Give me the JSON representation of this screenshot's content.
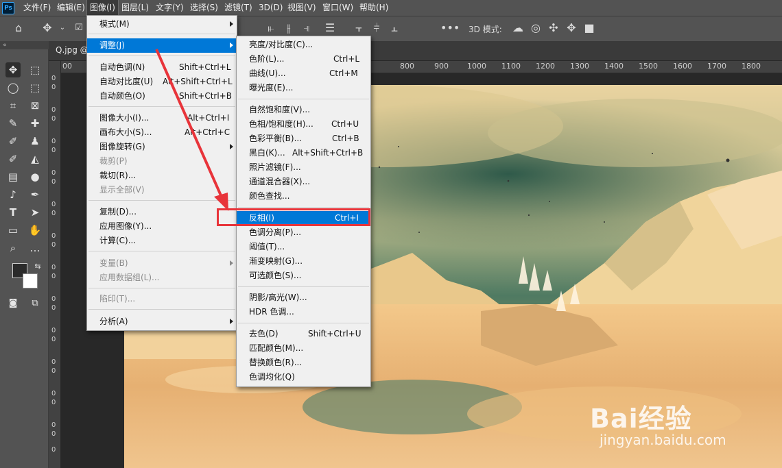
{
  "menubar": {
    "logo": "Ps",
    "items": [
      "文件(F)",
      "编辑(E)",
      "图像(I)",
      "图层(L)",
      "文字(Y)",
      "选择(S)",
      "滤镜(T)",
      "3D(D)",
      "视图(V)",
      "窗口(W)",
      "帮助(H)"
    ]
  },
  "options_bar": {
    "mode_3d_label": "3D 模式:"
  },
  "document": {
    "tab_label": "Q.jpg @",
    "ruler_h": [
      "00",
      "800",
      "900",
      "1000",
      "1100",
      "1200",
      "1300",
      "1400",
      "1500",
      "1600",
      "1700",
      "1800"
    ],
    "ruler_v": [
      "0",
      "0",
      "0",
      "0",
      "0",
      "0",
      "0",
      "0",
      "0",
      "0",
      "0",
      "0",
      "0",
      "0",
      "0",
      "0",
      "0",
      "0",
      "0",
      "0",
      "0",
      "0",
      "0",
      "0",
      "0",
      "0",
      "0",
      "0"
    ]
  },
  "image_menu": {
    "items": [
      {
        "label": "模式(M)",
        "shortcut": "",
        "disabled": false,
        "submenu": true
      },
      {
        "label": "调整(J)",
        "shortcut": "",
        "disabled": false,
        "submenu": true,
        "highlighted": true
      },
      {
        "label": "自动色调(N)",
        "shortcut": "Shift+Ctrl+L",
        "disabled": false
      },
      {
        "label": "自动对比度(U)",
        "shortcut": "Alt+Shift+Ctrl+L",
        "disabled": false
      },
      {
        "label": "自动颜色(O)",
        "shortcut": "Shift+Ctrl+B",
        "disabled": false
      },
      {
        "label": "图像大小(I)...",
        "shortcut": "Alt+Ctrl+I",
        "disabled": false
      },
      {
        "label": "画布大小(S)...",
        "shortcut": "Alt+Ctrl+C",
        "disabled": false
      },
      {
        "label": "图像旋转(G)",
        "shortcut": "",
        "disabled": false,
        "submenu": true
      },
      {
        "label": "裁剪(P)",
        "shortcut": "",
        "disabled": true
      },
      {
        "label": "裁切(R)...",
        "shortcut": "",
        "disabled": false
      },
      {
        "label": "显示全部(V)",
        "shortcut": "",
        "disabled": true
      },
      {
        "label": "复制(D)...",
        "shortcut": "",
        "disabled": false
      },
      {
        "label": "应用图像(Y)...",
        "shortcut": "",
        "disabled": false
      },
      {
        "label": "计算(C)...",
        "shortcut": "",
        "disabled": false
      },
      {
        "label": "变量(B)",
        "shortcut": "",
        "disabled": true,
        "submenu": true
      },
      {
        "label": "应用数据组(L)...",
        "shortcut": "",
        "disabled": true
      },
      {
        "label": "陷印(T)...",
        "shortcut": "",
        "disabled": true
      },
      {
        "label": "分析(A)",
        "shortcut": "",
        "disabled": false,
        "submenu": true
      }
    ]
  },
  "adjust_submenu": {
    "items": [
      {
        "label": "亮度/对比度(C)...",
        "shortcut": ""
      },
      {
        "label": "色阶(L)...",
        "shortcut": "Ctrl+L"
      },
      {
        "label": "曲线(U)...",
        "shortcut": "Ctrl+M"
      },
      {
        "label": "曝光度(E)...",
        "shortcut": ""
      },
      {
        "label": "自然饱和度(V)...",
        "shortcut": ""
      },
      {
        "label": "色相/饱和度(H)...",
        "shortcut": "Ctrl+U"
      },
      {
        "label": "色彩平衡(B)...",
        "shortcut": "Ctrl+B"
      },
      {
        "label": "黑白(K)...",
        "shortcut": "Alt+Shift+Ctrl+B"
      },
      {
        "label": "照片滤镜(F)...",
        "shortcut": ""
      },
      {
        "label": "通道混合器(X)...",
        "shortcut": ""
      },
      {
        "label": "颜色查找...",
        "shortcut": ""
      },
      {
        "label": "反相(I)",
        "shortcut": "Ctrl+I",
        "highlighted": true
      },
      {
        "label": "色调分离(P)...",
        "shortcut": ""
      },
      {
        "label": "阈值(T)...",
        "shortcut": ""
      },
      {
        "label": "渐变映射(G)...",
        "shortcut": ""
      },
      {
        "label": "可选颜色(S)...",
        "shortcut": ""
      },
      {
        "label": "阴影/高光(W)...",
        "shortcut": ""
      },
      {
        "label": "HDR 色调...",
        "shortcut": ""
      },
      {
        "label": "去色(D)",
        "shortcut": "Shift+Ctrl+U"
      },
      {
        "label": "匹配颜色(M)...",
        "shortcut": ""
      },
      {
        "label": "替换颜色(R)...",
        "shortcut": ""
      },
      {
        "label": "色调均化(Q)",
        "shortcut": ""
      }
    ]
  },
  "watermark": {
    "text": "Bai经验",
    "url": "jingyan.baidu.com"
  },
  "colors": {
    "menu_highlight": "#0078d7",
    "annotation": "#e8343a",
    "ui_panel": "#535353"
  }
}
